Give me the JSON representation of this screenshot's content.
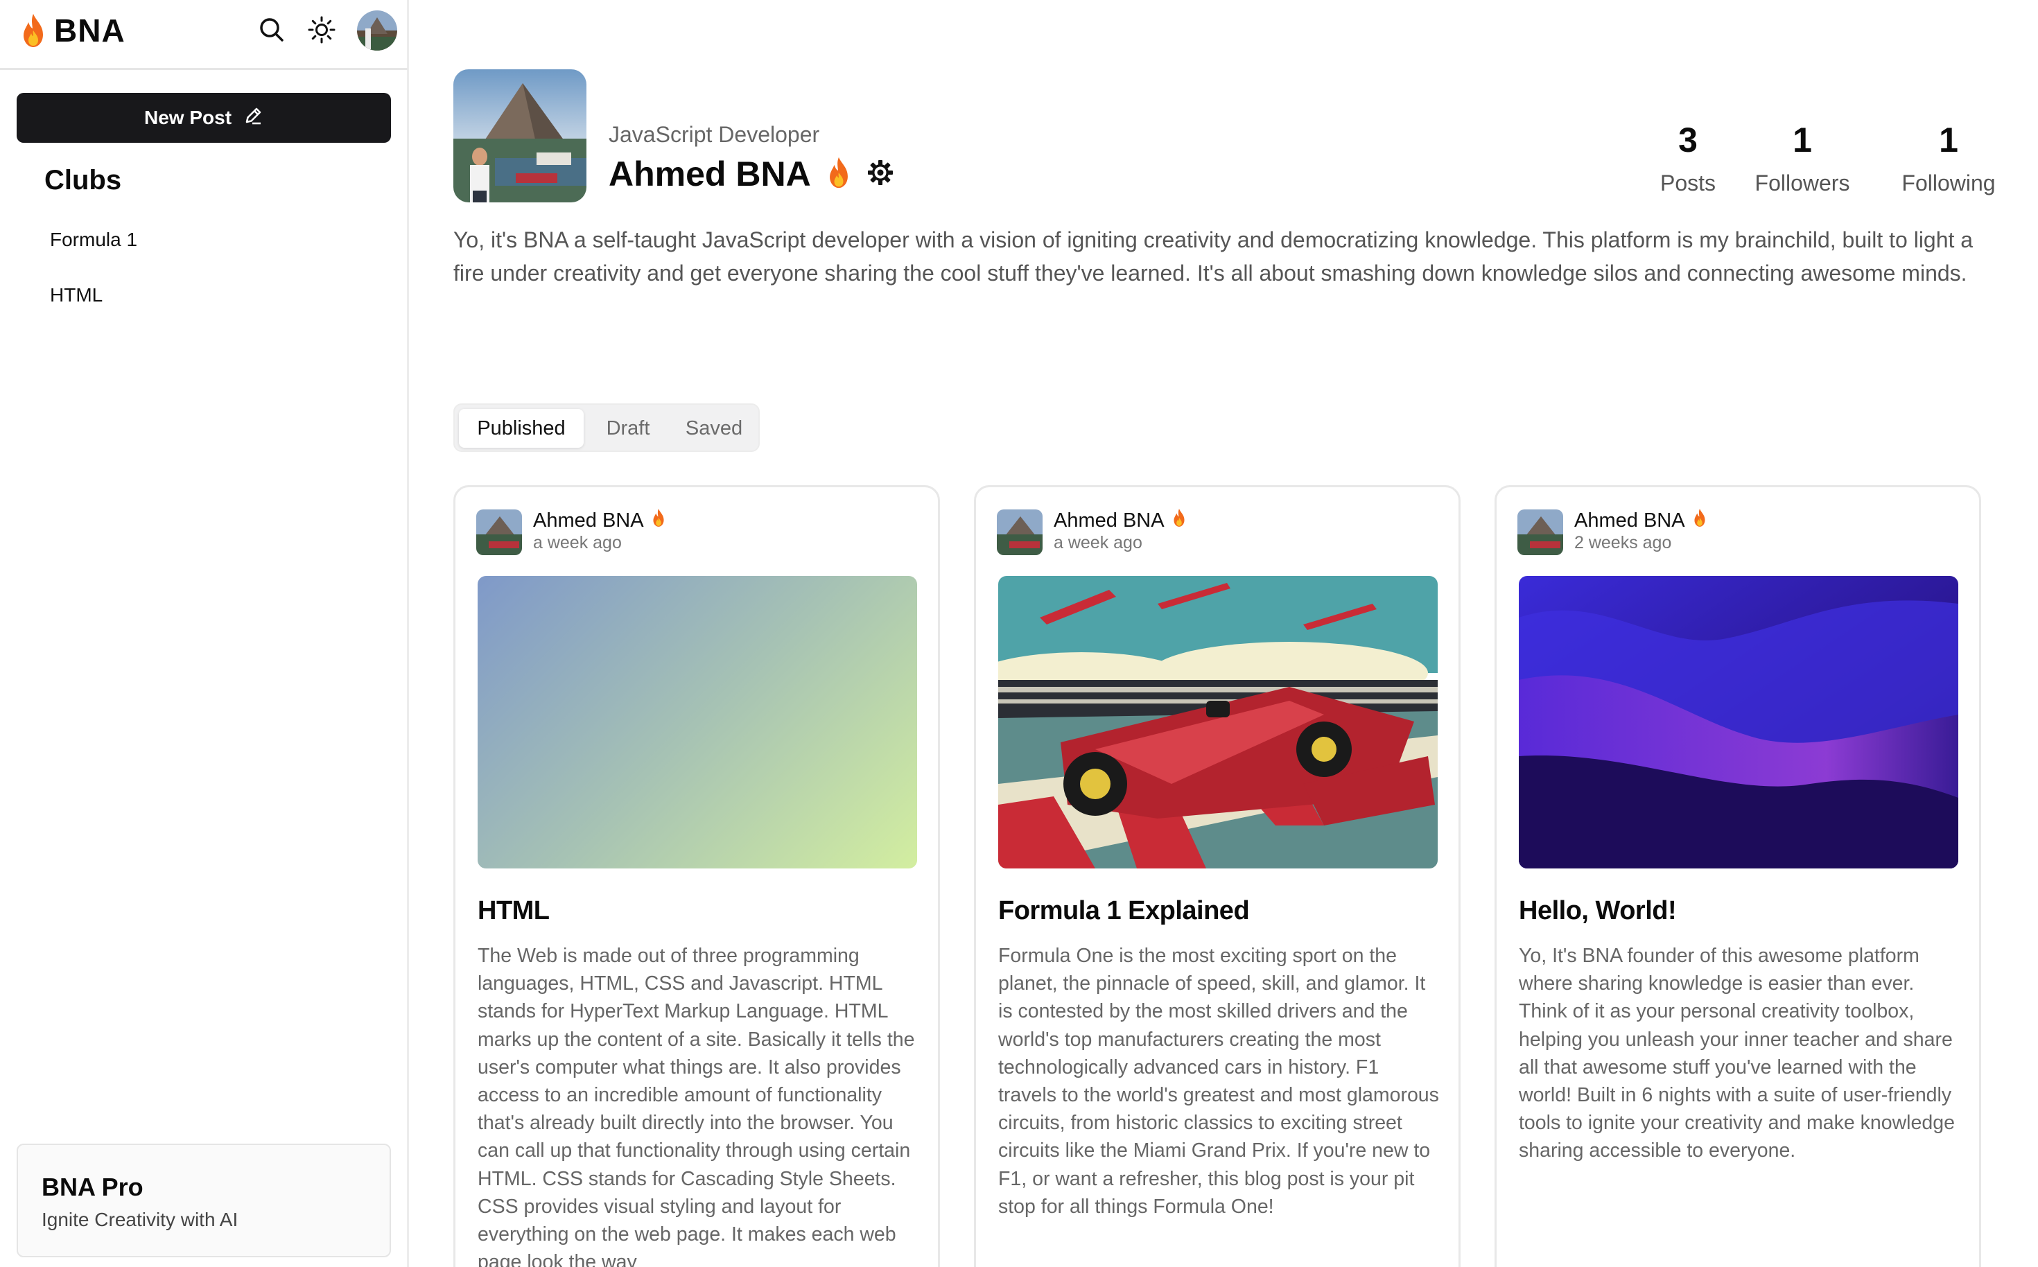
{
  "app": {
    "name": "BNA"
  },
  "topbar": {
    "icons": [
      "search-icon",
      "sun-icon"
    ]
  },
  "sidebar": {
    "new_post_label": "New Post",
    "clubs_title": "Clubs",
    "clubs": [
      {
        "label": "Formula 1"
      },
      {
        "label": "HTML"
      }
    ],
    "pro": {
      "title": "BNA Pro",
      "subtitle": "Ignite Creativity with AI"
    }
  },
  "profile": {
    "role": "JavaScript Developer",
    "name": "Ahmed BNA",
    "bio": "Yo, it's BNA a self-taught JavaScript developer with a vision of igniting creativity and democratizing knowledge. This platform is my brainchild, built to light a fire under creativity and get everyone sharing the cool stuff they've learned. It's all about smashing down knowledge silos and connecting awesome minds.",
    "stats": [
      {
        "value": "3",
        "label": "Posts"
      },
      {
        "value": "1",
        "label": "Followers"
      },
      {
        "value": "1",
        "label": "Following"
      }
    ]
  },
  "tabs": [
    {
      "label": "Published",
      "active": true
    },
    {
      "label": "Draft",
      "active": false
    },
    {
      "label": "Saved",
      "active": false
    }
  ],
  "posts": [
    {
      "author": "Ahmed BNA",
      "time": "a week ago",
      "title": "HTML",
      "body": "The Web is made out of three programming languages, HTML, CSS and Javascript. HTML stands for HyperText Markup Language. HTML marks up the content of a site. Basically it tells the user's computer what things are. It also provides access to an incredible amount of functionality that's already built directly into the browser. You can call up that functionality through using certain HTML. CSS stands for Cascading Style Sheets. CSS provides visual styling and layout for everything on the web page. It makes each web page look the way"
    },
    {
      "author": "Ahmed BNA",
      "time": "a week ago",
      "title": "Formula 1 Explained",
      "body": "Formula One is the most exciting sport on the planet, the pinnacle of speed, skill, and glamor. It is contested by the most skilled drivers and the world's top manufacturers creating the most technologically advanced cars in history. F1 travels to the world's greatest and most glamorous circuits, from historic classics to exciting street circuits like the Miami Grand Prix. If you're new to F1, or want a refresher, this blog post is your pit stop for all things Formula One!"
    },
    {
      "author": "Ahmed BNA",
      "time": "2 weeks ago",
      "title": "Hello, World!",
      "body": "Yo, It's BNA founder of this awesome platform where sharing knowledge is easier than ever. Think of it as your personal creativity toolbox, helping you unleash your inner teacher and share all that awesome stuff you've learned with the world! Built in 6 nights with a suite of user-friendly tools to ignite your creativity and make knowledge sharing accessible to everyone."
    }
  ],
  "colors": {
    "primary_button": "#18181b",
    "flame": "#f97316"
  }
}
